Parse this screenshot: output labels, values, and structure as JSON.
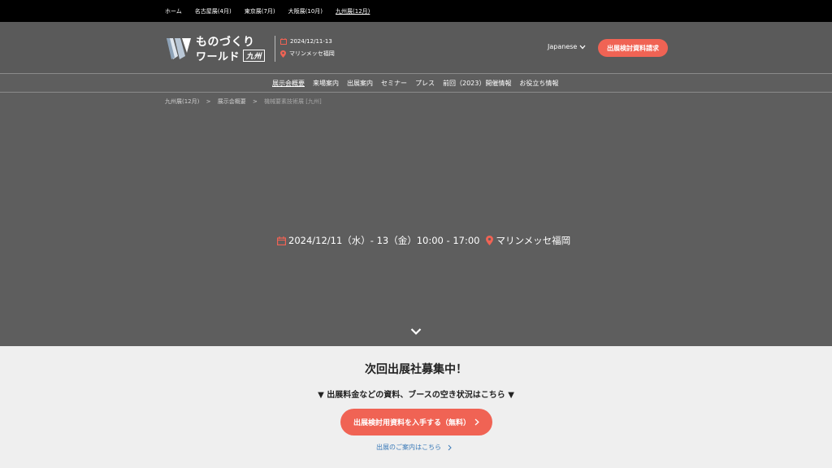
{
  "topnav": {
    "items": [
      "ホーム",
      "名古屋展(4月)",
      "東京展(7月)",
      "大阪展(10月)",
      "九州展(12月)"
    ]
  },
  "header": {
    "logo_line1": "ものづくり",
    "logo_line2": "ワールド",
    "logo_region": "九州",
    "date": "2024/12/11-13",
    "place": "マリンメッセ福岡",
    "lang": "Japanese",
    "cta": "出展検討資料請求"
  },
  "subnav": {
    "items": [
      "展示会概要",
      "来場案内",
      "出展案内",
      "セミナー",
      "プレス",
      "前回（2023）開催情報",
      "お役立ち情報"
    ]
  },
  "breadcrumb": {
    "items": [
      "九州展(12月)",
      ">",
      "展示会概要",
      ">",
      "機械要素技術展 [九州]"
    ]
  },
  "hero": {
    "datetime": "2024/12/11（水）- 13（金）10:00 - 17:00",
    "venue": "マリンメッセ福岡"
  },
  "recruit": {
    "title": "次回出展社募集中！",
    "lead": "▼ 出展料金などの資料、ブースの空き状況はこちら ▼",
    "button": "出展検討用資料を入手する（無料）",
    "link": "出展のご案内はこちら"
  },
  "colors": {
    "accent": "#f06354",
    "link": "#3b7ab8",
    "topbar": "#000000",
    "hero_bg": "#5e5e5e",
    "section_bg": "#efefef"
  }
}
